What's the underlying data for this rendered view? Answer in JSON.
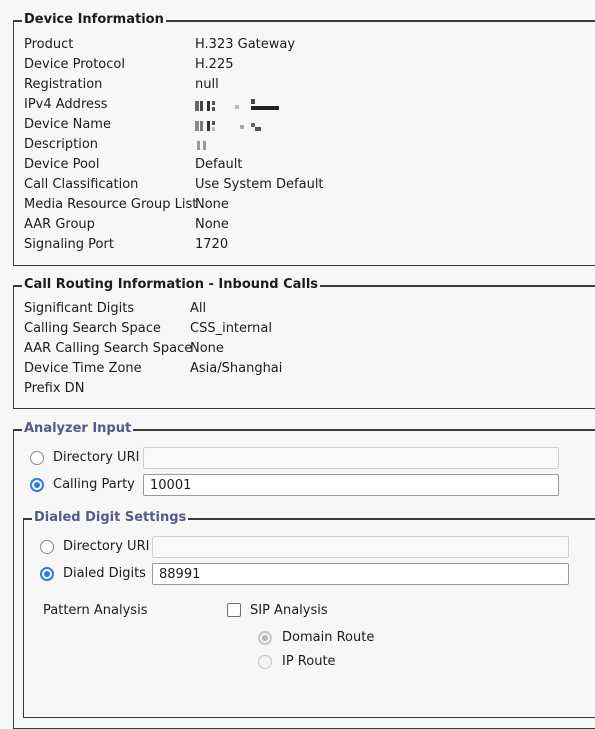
{
  "device_information": {
    "legend": "Device Information",
    "rows": [
      {
        "label": "Product",
        "value": "H.323 Gateway"
      },
      {
        "label": "Device Protocol",
        "value": "H.225"
      },
      {
        "label": "Registration",
        "value": "null"
      },
      {
        "label": "IPv4 Address",
        "value": null,
        "redacted": true
      },
      {
        "label": "Device Name",
        "value": null,
        "redacted": true
      },
      {
        "label": "Description",
        "value": null,
        "redacted": true
      },
      {
        "label": "Device Pool",
        "value": "Default"
      },
      {
        "label": "Call Classification",
        "value": "Use System Default"
      },
      {
        "label": "Media Resource Group List",
        "value": "None"
      },
      {
        "label": "AAR Group",
        "value": "None"
      },
      {
        "label": "Signaling Port",
        "value": "1720"
      }
    ]
  },
  "call_routing": {
    "legend": "Call Routing Information - Inbound Calls",
    "rows": [
      {
        "label": "Significant Digits",
        "value": "All"
      },
      {
        "label": "Calling Search Space",
        "value": "CSS_internal"
      },
      {
        "label": "AAR Calling Search Space",
        "value": "None"
      },
      {
        "label": "Device Time Zone",
        "value": "Asia/Shanghai"
      },
      {
        "label": "Prefix DN",
        "value": ""
      }
    ]
  },
  "analyzer_input": {
    "legend": "Analyzer Input",
    "options": [
      {
        "label": "Directory URI",
        "selected": false,
        "value": ""
      },
      {
        "label": "Calling Party",
        "selected": true,
        "value": "10001"
      }
    ],
    "dialed_digit_settings": {
      "legend": "Dialed Digit Settings",
      "options": [
        {
          "label": "Directory URI",
          "selected": false,
          "value": ""
        },
        {
          "label": "Dialed Digits",
          "selected": true,
          "value": "88991"
        }
      ],
      "pattern_analysis_label": "Pattern Analysis",
      "sip_analysis": {
        "label": "SIP Analysis",
        "checked": false
      },
      "route_options": [
        {
          "label": "Domain Route",
          "selected": true,
          "disabled": true
        },
        {
          "label": "IP Route",
          "selected": false,
          "disabled": true
        }
      ]
    }
  },
  "colors": {
    "accent_radio": "#2f7ae5",
    "legend_blue": "#56598a",
    "background": "#f7f7f7"
  }
}
